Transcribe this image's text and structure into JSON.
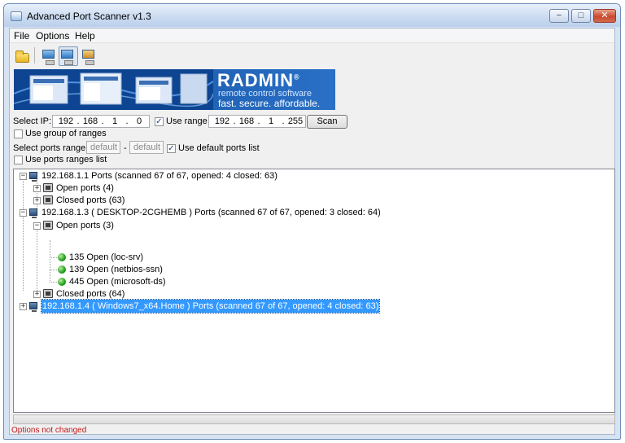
{
  "window": {
    "title": "Advanced Port Scanner v1.3",
    "buttons": {
      "minimize": "−",
      "maximize": "□",
      "close": "✕"
    }
  },
  "menu": [
    "File",
    "Options",
    "Help"
  ],
  "toolbar": {
    "buttons": [
      "open-icon",
      "scan-computer-icon",
      "scan-network-icon",
      "radmin-icon"
    ]
  },
  "banner": {
    "logo": "RADMIN",
    "registered": "®",
    "line2": "remote control software",
    "line3": "fast. secure. affordable."
  },
  "scan": {
    "select_ip_label": "Select IP:",
    "ip_from": [
      "192",
      "168",
      "1",
      "0"
    ],
    "use_range_label": "Use range",
    "use_range_checked": true,
    "ip_to": [
      "192",
      "168",
      "1",
      "255"
    ],
    "scan_button": "Scan",
    "use_group_label": "Use group of ranges",
    "use_group_checked": false,
    "ports_range_label": "Select ports range:",
    "port_from": "default",
    "port_dash": "-",
    "port_to": "default",
    "use_default_ports_label": "Use default ports list",
    "use_default_ports_checked": true,
    "use_ports_ranges_label": "Use ports ranges list",
    "use_ports_ranges_checked": false
  },
  "results": [
    {
      "type": "host",
      "text": "192.168.1.1     Ports (scanned 67 of 67, opened: 4 closed: 63)",
      "expander": "−"
    },
    {
      "type": "group",
      "text": "Open ports (4)",
      "expander": "+"
    },
    {
      "type": "group",
      "text": "Closed ports (63)",
      "expander": "+"
    },
    {
      "type": "host",
      "text": "192.168.1.3   ( DESKTOP-2CGHEMB )    Ports (scanned 67 of 67, opened: 3 closed: 64)",
      "expander": "−"
    },
    {
      "type": "group",
      "text": "Open ports (3)",
      "expander": "−"
    },
    {
      "type": "port",
      "text": "135 Open (loc-srv)"
    },
    {
      "type": "port",
      "text": "139 Open (netbios-ssn)"
    },
    {
      "type": "port",
      "text": "445 Open (microsoft-ds)"
    },
    {
      "type": "group",
      "text": "Closed ports (64)",
      "expander": "+"
    },
    {
      "type": "host",
      "text": "192.168.1.4   ( Windows7_x64.Home )     Ports (scanned 67 of 67, opened: 4 closed: 63)",
      "expander": "+",
      "selected": true
    }
  ],
  "status": "Options not changed"
}
